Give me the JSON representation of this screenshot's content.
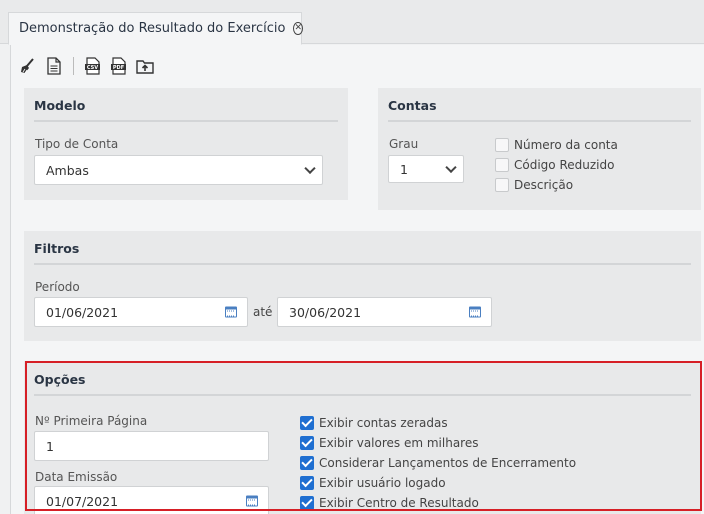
{
  "tab": {
    "title": "Demonstração do Resultado do Exercício"
  },
  "toolbar": {
    "icons": [
      "broom-icon",
      "document-icon",
      "csv-export-icon",
      "pdf-export-icon",
      "folder-upload-icon"
    ]
  },
  "modelo": {
    "title": "Modelo",
    "tipo_label": "Tipo de Conta",
    "tipo_value": "Ambas"
  },
  "contas": {
    "title": "Contas",
    "grau_label": "Grau",
    "grau_value": "1",
    "options": [
      {
        "label": "Número da conta",
        "checked": false
      },
      {
        "label": "Código Reduzido",
        "checked": false
      },
      {
        "label": "Descrição",
        "checked": false
      }
    ]
  },
  "filtros": {
    "title": "Filtros",
    "periodo_label": "Período",
    "date_from": "01/06/2021",
    "ate_label": "até",
    "date_to": "30/06/2021"
  },
  "opcoes": {
    "title": "Opções",
    "primeira_pagina_label": "Nº Primeira Página",
    "primeira_pagina_value": "1",
    "data_emissao_label": "Data Emissão",
    "data_emissao_value": "01/07/2021",
    "checks": [
      {
        "label": "Exibir contas zeradas",
        "checked": true
      },
      {
        "label": "Exibir valores em milhares",
        "checked": true
      },
      {
        "label": "Considerar Lançamentos de Encerramento",
        "checked": true
      },
      {
        "label": "Exibir usuário logado",
        "checked": true
      },
      {
        "label": "Exibir Centro de Resultado",
        "checked": true
      }
    ]
  },
  "colors": {
    "accent": "#1f6fd1",
    "highlight": "#d61f26",
    "calendar": "#4a7fc1"
  }
}
